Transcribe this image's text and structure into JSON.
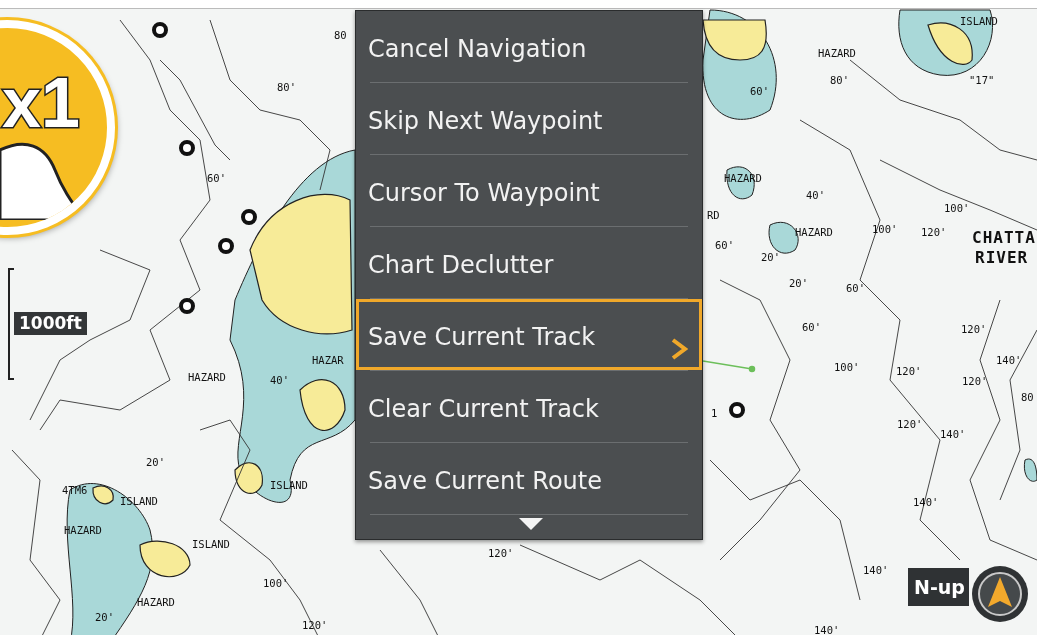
{
  "tutorial_badge": {
    "text": "x1"
  },
  "scale": {
    "label": "1000ft"
  },
  "orientation": {
    "label": "N-up"
  },
  "menu": {
    "items": [
      {
        "label": "Cancel Navigation",
        "selected": false,
        "submenu": false
      },
      {
        "label": "Skip Next Waypoint",
        "selected": false,
        "submenu": false
      },
      {
        "label": "Cursor To Waypoint",
        "selected": false,
        "submenu": false
      },
      {
        "label": "Chart Declutter",
        "selected": false,
        "submenu": false
      },
      {
        "label": "Save Current Track",
        "selected": true,
        "submenu": true
      },
      {
        "label": "Clear Current Track",
        "selected": false,
        "submenu": false
      },
      {
        "label": "Save Current Route",
        "selected": false,
        "submenu": false
      }
    ],
    "more_below": true
  },
  "map_labels": [
    {
      "kind": "depth",
      "text": "80"
    },
    {
      "kind": "depth",
      "text": "80'"
    },
    {
      "kind": "depth",
      "text": "60'"
    },
    {
      "kind": "feature",
      "text": "HAZARD"
    },
    {
      "kind": "depth",
      "text": "40'"
    },
    {
      "kind": "feature",
      "text": "HAZAR"
    },
    {
      "kind": "depth",
      "text": "20'"
    },
    {
      "kind": "feature",
      "text": "4TM6"
    },
    {
      "kind": "feature",
      "text": "ISLAND"
    },
    {
      "kind": "feature",
      "text": "ISLAND"
    },
    {
      "kind": "feature",
      "text": "HAZARD"
    },
    {
      "kind": "feature",
      "text": "ISLAND"
    },
    {
      "kind": "depth",
      "text": "100'"
    },
    {
      "kind": "feature",
      "text": "HAZARD"
    },
    {
      "kind": "depth",
      "text": "20'"
    },
    {
      "kind": "depth",
      "text": "120'"
    },
    {
      "kind": "depth",
      "text": "120'"
    },
    {
      "kind": "feature",
      "text": "ISLAND"
    },
    {
      "kind": "feature",
      "text": "HAZARD"
    },
    {
      "kind": "feature",
      "text": "\"17\""
    },
    {
      "kind": "depth",
      "text": "80'"
    },
    {
      "kind": "depth",
      "text": "60'"
    },
    {
      "kind": "feature",
      "text": "HAZARD"
    },
    {
      "kind": "depth",
      "text": "40'"
    },
    {
      "kind": "feature",
      "text": "RD"
    },
    {
      "kind": "feature",
      "text": "HAZARD"
    },
    {
      "kind": "depth",
      "text": "100'"
    },
    {
      "kind": "depth",
      "text": "120'"
    },
    {
      "kind": "depth",
      "text": "100'"
    },
    {
      "kind": "depth",
      "text": "60'"
    },
    {
      "kind": "depth",
      "text": "20'"
    },
    {
      "kind": "depth",
      "text": "20'"
    },
    {
      "kind": "depth",
      "text": "60'"
    },
    {
      "kind": "river",
      "text": "CHATTA"
    },
    {
      "kind": "river",
      "text": "RIVER"
    },
    {
      "kind": "depth",
      "text": "60'"
    },
    {
      "kind": "depth",
      "text": "100'"
    },
    {
      "kind": "depth",
      "text": "120'"
    },
    {
      "kind": "depth",
      "text": "120'"
    },
    {
      "kind": "depth",
      "text": "140'"
    },
    {
      "kind": "depth",
      "text": "120'"
    },
    {
      "kind": "depth",
      "text": "80"
    },
    {
      "kind": "depth",
      "text": "120'"
    },
    {
      "kind": "depth",
      "text": "140'"
    },
    {
      "kind": "depth",
      "text": "140'"
    },
    {
      "kind": "depth",
      "text": "140'"
    },
    {
      "kind": "depth",
      "text": "140'"
    },
    {
      "kind": "depth",
      "text": "1"
    }
  ]
}
